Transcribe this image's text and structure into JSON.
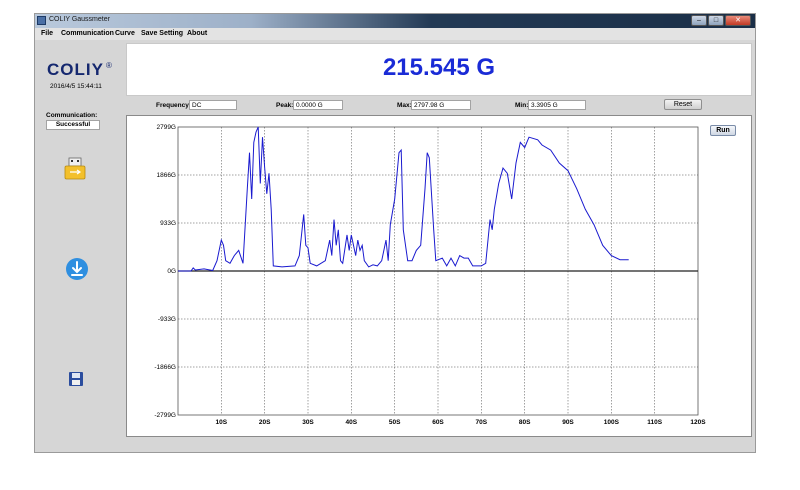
{
  "window": {
    "title": "COLIY Gaussmeter",
    "controls": {
      "minimize": "–",
      "maximize": "□",
      "close": "✕"
    }
  },
  "menu": [
    "File",
    "Communication",
    "Curve",
    "Save Setting",
    "About"
  ],
  "logo": {
    "text": "COLIY",
    "mark": "®"
  },
  "datetime": "2016/4/5 15:44:11",
  "reading": "215.545 G",
  "stats": {
    "frequency_label": "Frequency:",
    "frequency_value": "DC",
    "peak_label": "Peak:",
    "peak_value": "0.0000 G",
    "max_label": "Max:",
    "max_value": "2797.98 G",
    "min_label": "Min:",
    "min_value": "3.3905 G"
  },
  "reset_label": "Reset",
  "run_label": "Run",
  "communication": {
    "label": "Communication:",
    "status": "Successful"
  },
  "icons": {
    "usb": "usb-drive-icon",
    "download": "download-icon",
    "save": "floppy-save-icon"
  },
  "colors": {
    "reading": "#1a2bd6",
    "series": "#1a1acf",
    "logo": "#15286f"
  },
  "chart_data": {
    "type": "line",
    "xlim": [
      0,
      120
    ],
    "ylim": [
      -2799,
      2799
    ],
    "grid": true,
    "x_ticks": [
      "10S",
      "20S",
      "30S",
      "40S",
      "50S",
      "60S",
      "70S",
      "80S",
      "90S",
      "100S",
      "110S",
      "120S"
    ],
    "y_ticks": [
      {
        "value": 2799,
        "label": "2799G"
      },
      {
        "value": 1866,
        "label": "1866G"
      },
      {
        "value": 933,
        "label": "933G"
      },
      {
        "value": 0,
        "label": "0G"
      },
      {
        "value": -933,
        "label": "-933G"
      },
      {
        "value": -1866,
        "label": "-1866G"
      },
      {
        "value": -2799,
        "label": "-2799G"
      }
    ],
    "series": [
      {
        "color": "#1a1acf",
        "points": [
          [
            0,
            0
          ],
          [
            3,
            0
          ],
          [
            3.5,
            60
          ],
          [
            4,
            20
          ],
          [
            6,
            40
          ],
          [
            8,
            10
          ],
          [
            9,
            200
          ],
          [
            10,
            600
          ],
          [
            10.5,
            500
          ],
          [
            11,
            200
          ],
          [
            12,
            150
          ],
          [
            13,
            300
          ],
          [
            14,
            400
          ],
          [
            15,
            150
          ],
          [
            16,
            1600
          ],
          [
            16.5,
            2300
          ],
          [
            17,
            1400
          ],
          [
            17.5,
            2500
          ],
          [
            18,
            2700
          ],
          [
            18.5,
            2799
          ],
          [
            19,
            1700
          ],
          [
            19.5,
            2600
          ],
          [
            20,
            2000
          ],
          [
            20.5,
            1500
          ],
          [
            21,
            1900
          ],
          [
            21.5,
            1200
          ],
          [
            22,
            100
          ],
          [
            24,
            80
          ],
          [
            27,
            100
          ],
          [
            28,
            300
          ],
          [
            29,
            1100
          ],
          [
            29.5,
            500
          ],
          [
            30,
            450
          ],
          [
            30.5,
            150
          ],
          [
            32,
            100
          ],
          [
            34,
            200
          ],
          [
            35,
            600
          ],
          [
            35.5,
            300
          ],
          [
            36,
            1000
          ],
          [
            36.5,
            500
          ],
          [
            37,
            800
          ],
          [
            37.5,
            200
          ],
          [
            38,
            150
          ],
          [
            39,
            700
          ],
          [
            39.5,
            400
          ],
          [
            40,
            700
          ],
          [
            41,
            300
          ],
          [
            41.5,
            600
          ],
          [
            42,
            400
          ],
          [
            42.5,
            500
          ],
          [
            43,
            200
          ],
          [
            44,
            80
          ],
          [
            45,
            120
          ],
          [
            46,
            100
          ],
          [
            47,
            200
          ],
          [
            48,
            600
          ],
          [
            48.5,
            200
          ],
          [
            49,
            900
          ],
          [
            50,
            1400
          ],
          [
            51,
            2300
          ],
          [
            51.5,
            2350
          ],
          [
            52,
            800
          ],
          [
            53,
            200
          ],
          [
            54,
            200
          ],
          [
            55,
            400
          ],
          [
            56,
            500
          ],
          [
            57,
            1600
          ],
          [
            57.5,
            2300
          ],
          [
            58,
            2200
          ],
          [
            59,
            800
          ],
          [
            59.5,
            200
          ],
          [
            61,
            250
          ],
          [
            62,
            100
          ],
          [
            63,
            250
          ],
          [
            64,
            100
          ],
          [
            65,
            300
          ],
          [
            66,
            250
          ],
          [
            67,
            250
          ],
          [
            68,
            100
          ],
          [
            70,
            100
          ],
          [
            71,
            150
          ],
          [
            72,
            1000
          ],
          [
            72.5,
            800
          ],
          [
            73,
            1200
          ],
          [
            74,
            1700
          ],
          [
            75,
            2000
          ],
          [
            76,
            1900
          ],
          [
            77,
            1400
          ],
          [
            78,
            2100
          ],
          [
            79,
            2500
          ],
          [
            80,
            2400
          ],
          [
            81,
            2600
          ],
          [
            83,
            2550
          ],
          [
            84,
            2450
          ],
          [
            86,
            2350
          ],
          [
            88,
            2100
          ],
          [
            90,
            1950
          ],
          [
            92,
            1600
          ],
          [
            94,
            1200
          ],
          [
            96,
            900
          ],
          [
            98,
            500
          ],
          [
            100,
            300
          ],
          [
            102,
            220
          ],
          [
            104,
            220
          ]
        ]
      }
    ]
  }
}
